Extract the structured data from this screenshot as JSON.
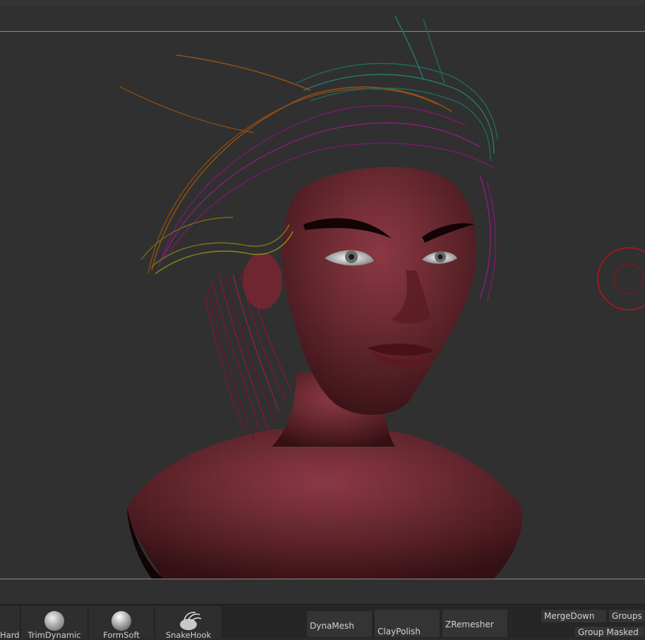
{
  "brushes": [
    {
      "label": "Hard",
      "icon": "standard-brush-icon"
    },
    {
      "label": "TrimDynamic",
      "icon": "sphere-brush-icon"
    },
    {
      "label": "FormSoft",
      "icon": "sphere-soft-brush-icon"
    },
    {
      "label": "SnakeHook",
      "icon": "snakehook-brush-icon"
    }
  ],
  "tool_buttons": {
    "dynamesh": "DynaMesh",
    "claypolish": "ClayPolish",
    "zremesher": "ZRemesher",
    "mergedown": "MergeDown",
    "groups_split": "Groups S",
    "group_masked": "Group Masked"
  },
  "colors": {
    "canvas": "#303030",
    "skin": "#8a3540",
    "brush_cursor": "#c0101a",
    "hair_colors": [
      "#8b1030",
      "#7a1a6e",
      "#8a4a12",
      "#1f6b5c",
      "#7a7a18"
    ]
  }
}
